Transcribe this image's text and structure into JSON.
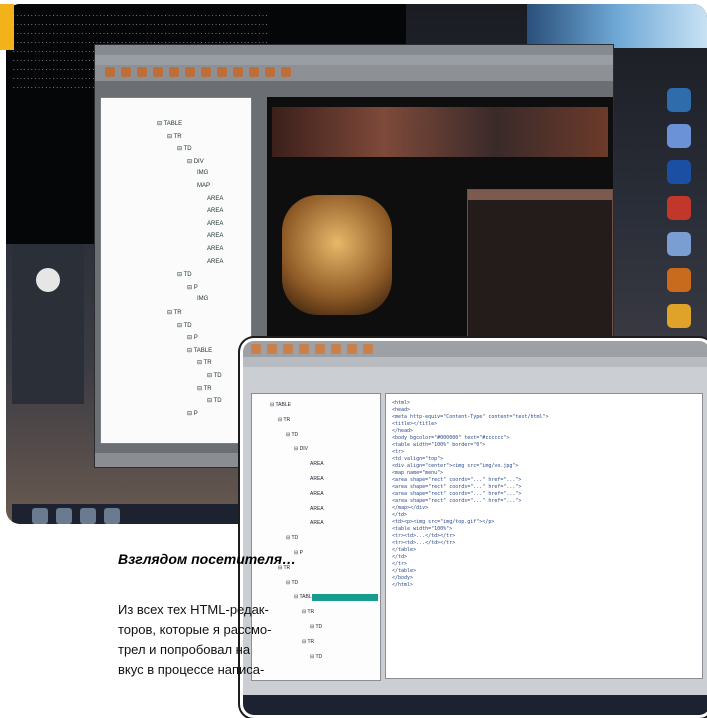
{
  "caption": "Взглядом посетителя…",
  "article_lines": [
    "Из всех тех HTML-редак-",
    "торов, которые я рассмо-",
    "трел и попробовал на",
    "вкус в процессе написа-"
  ],
  "colors": {
    "accent_orange": "#f3b21a",
    "terminal_bg": "#050607",
    "preview_bg": "#0f0e0e",
    "taskbar_bg": "#1c2230",
    "tree_highlight": "#169b8e"
  },
  "screenshot1": {
    "tree_nodes": [
      {
        "label": "⊟ TABLE",
        "indent": 0
      },
      {
        "label": "⊟ TR",
        "indent": 1
      },
      {
        "label": "⊟ TD",
        "indent": 2
      },
      {
        "label": "⊟ DIV",
        "indent": 3
      },
      {
        "label": "IMG",
        "indent": 4
      },
      {
        "label": "MAP",
        "indent": 4
      },
      {
        "label": "AREA",
        "indent": 5
      },
      {
        "label": "AREA",
        "indent": 5
      },
      {
        "label": "AREA",
        "indent": 5
      },
      {
        "label": "AREA",
        "indent": 5
      },
      {
        "label": "AREA",
        "indent": 5
      },
      {
        "label": "AREA",
        "indent": 5
      },
      {
        "label": "⊟ TD",
        "indent": 2
      },
      {
        "label": "⊟ P",
        "indent": 3
      },
      {
        "label": "IMG",
        "indent": 4
      },
      {
        "label": "⊟ TR",
        "indent": 1
      },
      {
        "label": "⊟ TD",
        "indent": 2
      },
      {
        "label": "⊟ P",
        "indent": 3
      },
      {
        "label": "⊟ TABLE",
        "indent": 3
      },
      {
        "label": "⊟ TR",
        "indent": 4
      },
      {
        "label": "⊟ TD",
        "indent": 5
      },
      {
        "label": "⊟ TR",
        "indent": 4
      },
      {
        "label": "⊟ TD",
        "indent": 5
      },
      {
        "label": "⊟ P",
        "indent": 3
      }
    ]
  },
  "screenshot2": {
    "tree_nodes": [
      {
        "label": "⊟ TABLE",
        "indent": 0
      },
      {
        "label": "⊟ TR",
        "indent": 1
      },
      {
        "label": "⊟ TD",
        "indent": 2
      },
      {
        "label": "⊟ DIV",
        "indent": 3
      },
      {
        "label": "AREA",
        "indent": 5
      },
      {
        "label": "AREA",
        "indent": 5
      },
      {
        "label": "AREA",
        "indent": 5
      },
      {
        "label": "AREA",
        "indent": 5
      },
      {
        "label": "AREA",
        "indent": 5
      },
      {
        "label": "⊟ TD",
        "indent": 2
      },
      {
        "label": "⊟ P",
        "indent": 3
      },
      {
        "label": "⊟ TR",
        "indent": 1
      },
      {
        "label": "⊟ TD",
        "indent": 2
      },
      {
        "label": "⊟ TABLE",
        "indent": 3
      },
      {
        "label": "⊟ TR",
        "indent": 4
      },
      {
        "label": "⊟ TD",
        "indent": 5
      },
      {
        "label": "⊟ TR",
        "indent": 4
      },
      {
        "label": "⊟ TD",
        "indent": 5
      }
    ],
    "code_lines": [
      "<html>",
      "<head>",
      "<meta http-equiv=\"Content-Type\" content=\"text/html\">",
      "<title></title>",
      "</head>",
      "<body bgcolor=\"#000000\" text=\"#cccccc\">",
      "<table width=\"100%\" border=\"0\">",
      "<tr>",
      "<td valign=\"top\">",
      "<div align=\"center\"><img src=\"img/vo.jpg\">",
      "<map name=\"menu\">",
      "<area shape=\"rect\" coords=\"...\" href=\"...\">",
      "<area shape=\"rect\" coords=\"...\" href=\"...\">",
      "<area shape=\"rect\" coords=\"...\" href=\"...\">",
      "<area shape=\"rect\" coords=\"...\" href=\"...\">",
      "</map></div>",
      "</td>",
      "<td><p><img src=\"img/top.gif\"></p>",
      "<table width=\"100%\">",
      "<tr><td>...</td></tr>",
      "<tr><td>...</td></tr>",
      "</table>",
      "</td>",
      "</tr>",
      "</table>",
      "</body>",
      "</html>"
    ]
  }
}
